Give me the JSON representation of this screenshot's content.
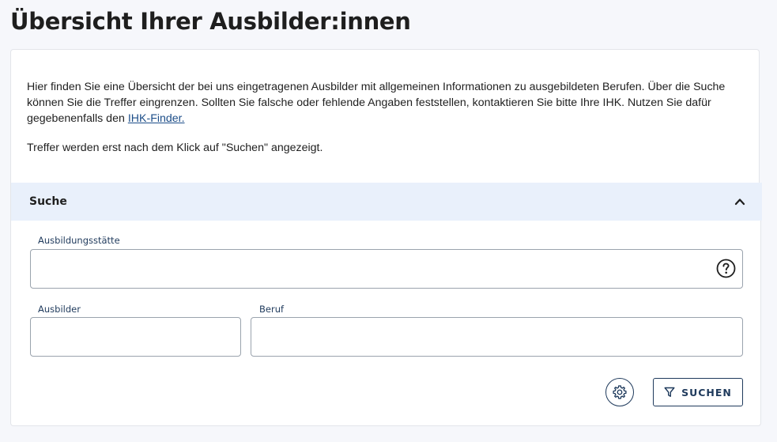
{
  "page": {
    "title": "Übersicht Ihrer Ausbilder:innen"
  },
  "info": {
    "text_before_link": "Hier finden Sie eine Übersicht der bei uns eingetragenen Ausbilder mit allgemeinen Informationen zu ausgebildeten Berufen. Über die Suche können Sie die Treffer eingrenzen. Sollten Sie falsche oder fehlende Angaben feststellen, kontaktieren Sie bitte Ihre IHK. Nutzen Sie dafür gegebenenfalls den ",
    "link_text": "IHK-Finder.",
    "hint": "Treffer werden erst nach dem Klick auf \"Suchen\" angezeigt."
  },
  "search": {
    "title": "Suche",
    "collapse_icon": "chevron-up-icon",
    "fields": {
      "ausbildungsstaette": {
        "label": "Ausbildungsstätte",
        "value": "",
        "help_icon": "question-circle-icon"
      },
      "ausbilder": {
        "label": "Ausbilder",
        "value": ""
      },
      "beruf": {
        "label": "Beruf",
        "value": ""
      }
    },
    "settings_icon": "gear-icon",
    "submit": {
      "label": "SUCHEN",
      "icon": "filter-icon"
    }
  },
  "colors": {
    "background": "#f6f7fb",
    "panel_header": "#e9f0fb",
    "accent": "#1f3a5c",
    "link": "#1d4e89"
  }
}
